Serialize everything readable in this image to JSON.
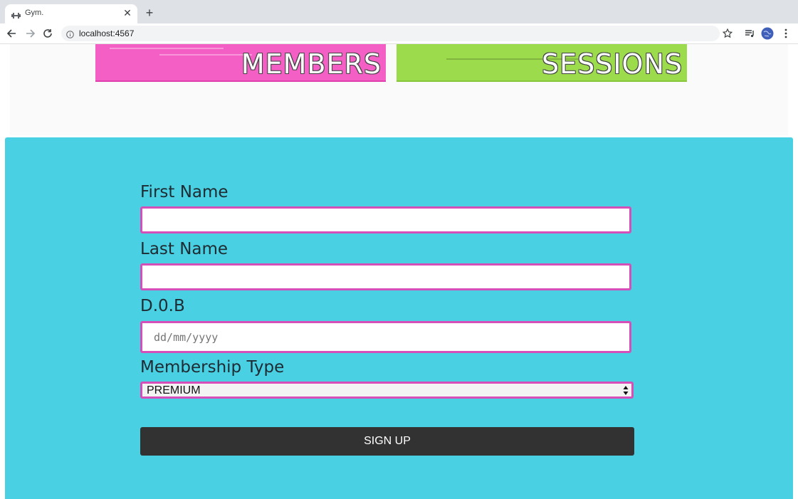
{
  "browser": {
    "tab_title": "Gym.",
    "url": "localhost:4567"
  },
  "banners": {
    "members": "MEMBERS",
    "sessions": "SESSIONS"
  },
  "form": {
    "first_name_label": "First Name",
    "first_name_value": "",
    "last_name_label": "Last Name",
    "last_name_value": "",
    "dob_label": "D.0.B",
    "dob_placeholder": "dd/mm/yyyy",
    "membership_label": "Membership Type",
    "membership_selected": "PREMIUM",
    "submit_label": "SIGN UP"
  },
  "colors": {
    "members_banner": "#f45fc6",
    "sessions_banner": "#9cdc4c",
    "form_background": "#49d0e2",
    "input_border": "#d64fb8",
    "button": "#333233"
  }
}
